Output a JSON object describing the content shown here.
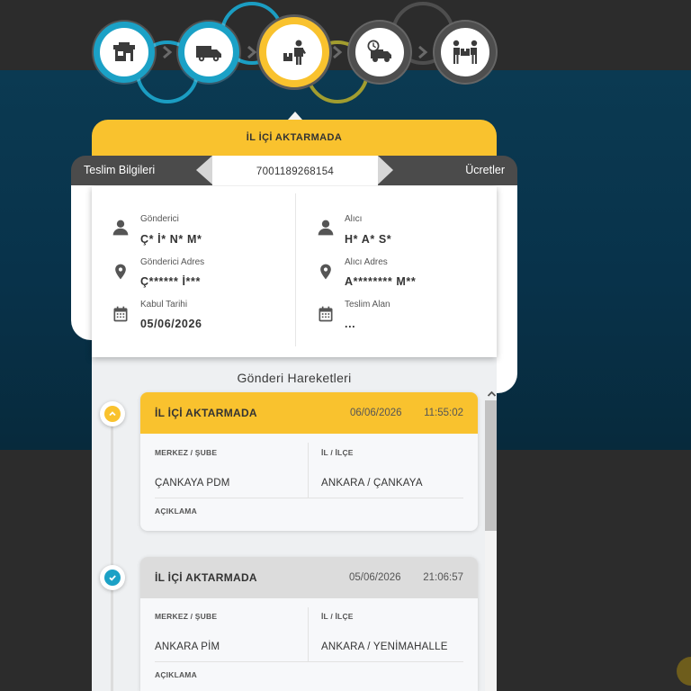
{
  "steps": [
    {
      "icon": "branch-office-icon",
      "state": "completed"
    },
    {
      "icon": "truck-icon",
      "state": "completed"
    },
    {
      "icon": "transfer-person-package-icon",
      "state": "current"
    },
    {
      "icon": "scheduled-delivery-truck-icon",
      "state": "pending"
    },
    {
      "icon": "package-handover-icon",
      "state": "pending"
    }
  ],
  "status_header": "İL İÇİ AKTARMADA",
  "tabs": {
    "delivery_info": "Teslim Bilgileri",
    "tracking_number": "7001189268154",
    "fees": "Ücretler"
  },
  "shipment": {
    "sender": {
      "label": "Gönderici",
      "value": "Ç* İ* N* M*"
    },
    "sender_address": {
      "label": "Gönderici Adres",
      "value": "Ç****** İ***"
    },
    "accept_date": {
      "label": "Kabul Tarihi",
      "value": "05/06/2026"
    },
    "receiver": {
      "label": "Alıcı",
      "value": "H* A* S*"
    },
    "receiver_address": {
      "label": "Alıcı Adres",
      "value": "A******** M**"
    },
    "delivered_to": {
      "label": "Teslim Alan",
      "value": "..."
    }
  },
  "movements_title": "Gönderi Hareketleri",
  "movements": [
    {
      "status": "İL İÇİ AKTARMADA",
      "date": "06/06/2026",
      "time": "11:55:02",
      "branch_label": "MERKEZ / ŞUBE",
      "branch": "ÇANKAYA PDM",
      "city_label": "İL / İLÇE",
      "city": "ANKARA / ÇANKAYA",
      "description_label": "AÇIKLAMA",
      "state": "current",
      "marker_icon": "chevron-up-icon"
    },
    {
      "status": "İL İÇİ AKTARMADA",
      "date": "05/06/2026",
      "time": "21:06:57",
      "branch_label": "MERKEZ / ŞUBE",
      "branch": "ANKARA PİM",
      "city_label": "İL / İLÇE",
      "city": "ANKARA / YENİMAHALLE",
      "description_label": "AÇIKLAMA",
      "state": "completed",
      "marker_icon": "check-icon"
    }
  ],
  "colors": {
    "accent_yellow": "#f9c22e",
    "accent_teal": "#1ba1c6",
    "tab_dark": "#4b4b4b",
    "pending_gray": "#555555",
    "card_header_gray": "#dcdcdc"
  }
}
